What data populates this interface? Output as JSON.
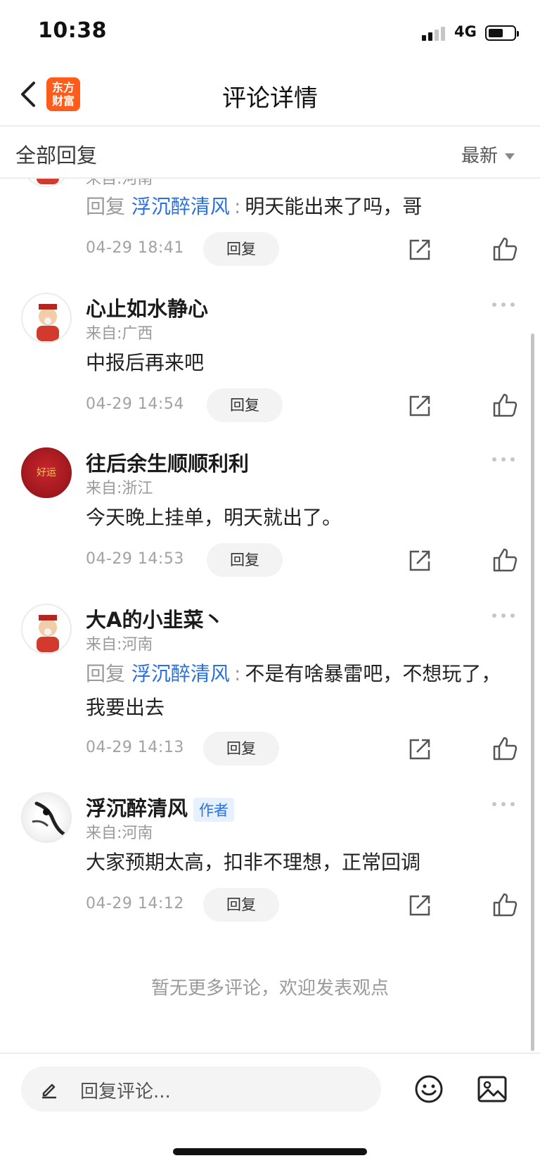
{
  "status_bar": {
    "time": "10:38",
    "network": "4G"
  },
  "nav": {
    "title": "评论详情",
    "logo_text": "东方财富"
  },
  "reply_header": {
    "label": "全部回复",
    "sort": "最新"
  },
  "comments": [
    {
      "username": "",
      "location": "来自:河南",
      "reply_prefix": "回复",
      "mention": "浮沉醉清风",
      "text": "明天能出来了吗，哥",
      "time": "04-29 18:41",
      "reply_label": "回复"
    },
    {
      "username": "心止如水静心",
      "location": "来自:广西",
      "text": "中报后再来吧",
      "time": "04-29 14:54",
      "reply_label": "回复"
    },
    {
      "username": "往后余生顺顺利利",
      "location": "来自:浙江",
      "avatar_text": "好运",
      "text": "今天晚上挂单，明天就出了。",
      "time": "04-29 14:53",
      "reply_label": "回复"
    },
    {
      "username": "大A的小韭菜丶",
      "location": "来自:河南",
      "reply_prefix": "回复",
      "mention": "浮沉醉清风",
      "text": "不是有啥暴雷吧，不想玩了，我要出去",
      "time": "04-29 14:13",
      "reply_label": "回复"
    },
    {
      "username": "浮沉醉清风",
      "badge": "作者",
      "location": "来自:河南",
      "text": "大家预期太高，扣非不理想，正常回调",
      "time": "04-29 14:12",
      "reply_label": "回复"
    }
  ],
  "footer_note": "暂无更多评论，欢迎发表观点",
  "input": {
    "placeholder": "回复评论..."
  },
  "icons": [
    "back-icon",
    "share-icon",
    "like-icon",
    "more-icon",
    "pen-icon",
    "emoji-icon",
    "image-icon"
  ],
  "colors": {
    "mention": "#2a6fe0",
    "logo": "#ff5b1a",
    "badge_bg": "#e6f0ff"
  }
}
